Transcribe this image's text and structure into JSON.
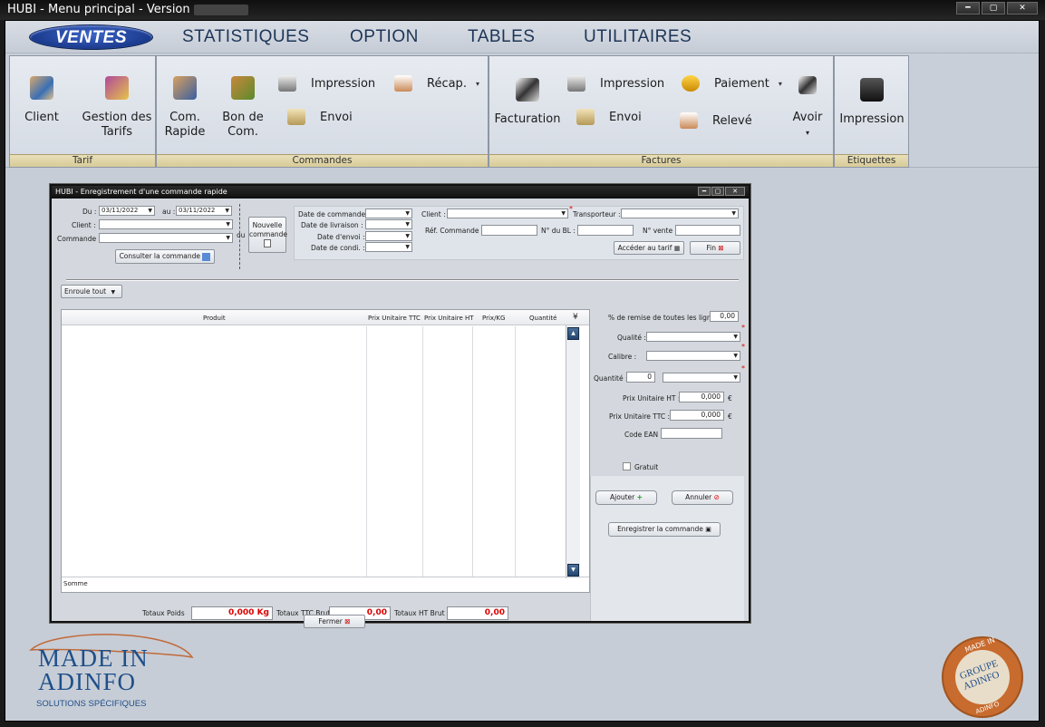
{
  "window": {
    "title": "HUBI - Menu principal - Version"
  },
  "menu": {
    "items": [
      "VENTES",
      "STATISTIQUES",
      "OPTION",
      "TABLES",
      "UTILITAIRES"
    ]
  },
  "ribbon": {
    "tarif": {
      "label": "Tarif",
      "client": "Client",
      "gestion_line1": "Gestion des",
      "gestion_line2": "Tarifs"
    },
    "commandes": {
      "label": "Commandes",
      "com_rapide_1": "Com.",
      "com_rapide_2": "Rapide",
      "bon_1": "Bon de",
      "bon_2": "Com.",
      "impression": "Impression",
      "envoi": "Envoi",
      "recap": "Récap."
    },
    "factures": {
      "label": "Factures",
      "facturation": "Facturation",
      "impression": "Impression",
      "envoi": "Envoi",
      "paiement": "Paiement",
      "releve": "Relevé",
      "avoir": "Avoir"
    },
    "etiquettes": {
      "label": "Etiquettes",
      "impression": "Impression"
    }
  },
  "dialog": {
    "title": "HUBI - Enregistrement d'une commande rapide",
    "du_label": "Du :",
    "du_value": "03/11/2022",
    "au_label": "au :",
    "au_value": "03/11/2022",
    "client_label": "Client :",
    "commande_label": "Commande :",
    "ou": "ou",
    "nouvelle_1": "Nouvelle",
    "nouvelle_2": "commande",
    "consulter": "Consulter la commande",
    "date_commande": "Date de commande :",
    "date_livraison": "Date de livraison :",
    "date_envoi": "Date d'envoi :",
    "date_condi": "Date de condi. :",
    "client2_label": "Client :",
    "transporteur_label": "Transporteur :",
    "ref_commande": "Réf. Commande :",
    "num_bl": "N° du BL :",
    "num_vente": "N° vente :",
    "acceder_tarif": "Accéder au tarif",
    "fin": "Fin",
    "enroule": "Enroule tout",
    "columns": [
      "Produit",
      "Prix Unitaire TTC",
      "Prix Unitaire HT",
      "Prix/KG",
      "Quantité"
    ],
    "somme": "Somme",
    "totaux_poids_label": "Totaux Poids",
    "totaux_poids_value": "0,000 Kg",
    "totaux_ttc_label": "Totaux TTC Brut",
    "totaux_ttc_value": "0,00",
    "totaux_ht_label": "Totaux HT Brut",
    "totaux_ht_value": "0,00",
    "fermer": "Fermer",
    "remise_label": "% de remise de toutes les lignes :",
    "remise_value": "0,00",
    "qualite_label": "Qualité :",
    "calibre_label": "Calibre :",
    "quantite_label": "Quantité :",
    "quantite_value": "0",
    "pu_ht_label": "Prix Unitaire HT :",
    "pu_ht_value": "0,000",
    "pu_ttc_label": "Prix Unitaire TTC :",
    "pu_ttc_value": "0,000",
    "euro": "€",
    "ean_label": "Code EAN :",
    "gratuit": "Gratuit",
    "ajouter": "Ajouter",
    "annuler": "Annuler",
    "enregistrer": "Enregistrer la commande"
  },
  "logos": {
    "left_line1": "MADE IN",
    "left_line2": "ADINFO",
    "left_line3": "SOLUTIONS SPÉCIFIQUES",
    "right_top": "MADE IN",
    "right_mid1": "GROUPE",
    "right_mid2": "ADINFO",
    "right_bottom": "ADINFO"
  }
}
